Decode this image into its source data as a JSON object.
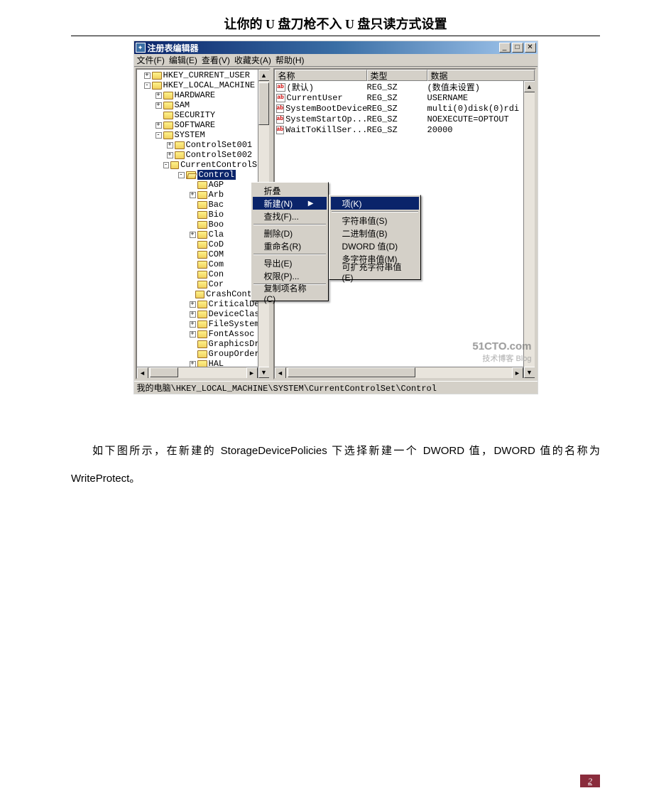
{
  "page": {
    "title": "让你的 U 盘刀枪不入  U 盘只读方式设置",
    "paragraph": "如下图所示，在新建的 StorageDevicePolicies 下选择新建一个 DWORD 值，DWORD 值的名称为 WriteProtect。",
    "number": "2"
  },
  "window": {
    "title": "注册表编辑器",
    "menus": {
      "file": "文件(F)",
      "edit": "编辑(E)",
      "view": "查看(V)",
      "favorites": "收藏夹(A)",
      "help": "帮助(H)"
    },
    "status": "我的电脑\\HKEY_LOCAL_MACHINE\\SYSTEM\\CurrentControlSet\\Control",
    "watermark": {
      "line1": "51CTO.com",
      "line2": "技术博客   Blog"
    }
  },
  "tree": {
    "top": [
      {
        "depth": 0,
        "toggle": "+",
        "label": "HKEY_CURRENT_USER"
      },
      {
        "depth": 0,
        "toggle": "-",
        "label": "HKEY_LOCAL_MACHINE"
      },
      {
        "depth": 1,
        "toggle": "+",
        "label": "HARDWARE"
      },
      {
        "depth": 1,
        "toggle": "+",
        "label": "SAM"
      },
      {
        "depth": 1,
        "toggle": "",
        "label": "SECURITY"
      },
      {
        "depth": 1,
        "toggle": "+",
        "label": "SOFTWARE"
      },
      {
        "depth": 1,
        "toggle": "-",
        "label": "SYSTEM"
      },
      {
        "depth": 2,
        "toggle": "+",
        "label": "ControlSet001"
      },
      {
        "depth": 2,
        "toggle": "+",
        "label": "ControlSet002"
      },
      {
        "depth": 2,
        "toggle": "-",
        "label": "CurrentControlSet"
      },
      {
        "depth": 3,
        "toggle": "-",
        "label": "Control",
        "selected": true,
        "open": true
      }
    ],
    "children": [
      "AGP",
      "Arb",
      "Bac",
      "Bio",
      "Boo",
      "Cla",
      "CoD",
      "COM",
      "Com",
      "Con",
      "Cor",
      "CrashControl",
      "CriticalDe",
      "DeviceClas",
      "FileSystem",
      "FontAssoc",
      "GraphicsDr",
      "GroupOrder",
      "HAL"
    ],
    "childToggles": [
      "",
      "+",
      "",
      "",
      "",
      "+",
      "",
      "",
      "",
      "",
      "",
      "",
      "+",
      "+",
      "+",
      "+",
      "",
      "",
      "+"
    ]
  },
  "list": {
    "headers": {
      "name": "名称",
      "type": "类型",
      "data": "数据"
    },
    "rows": [
      {
        "name": "(默认)",
        "type": "REG_SZ",
        "data": "(数值未设置)"
      },
      {
        "name": "CurrentUser",
        "type": "REG_SZ",
        "data": "USERNAME"
      },
      {
        "name": "SystemBootDevice",
        "type": "REG_SZ",
        "data": "multi(0)disk(0)rdi"
      },
      {
        "name": "SystemStartOp...",
        "type": "REG_SZ",
        "data": "NOEXECUTE=OPTOUT"
      },
      {
        "name": "WaitToKillSer...",
        "type": "REG_SZ",
        "data": "20000"
      }
    ]
  },
  "contextMenu": {
    "items": {
      "collapse": "折叠",
      "new": "新建(N)",
      "find": "查找(F)...",
      "delete": "删除(D)",
      "rename": "重命名(R)",
      "export": "导出(E)",
      "permissions": "权限(P)...",
      "copyKeyName": "复制项名称(C)"
    },
    "newSubmenu": {
      "key": "项(K)",
      "string": "字符串值(S)",
      "binary": "二进制值(B)",
      "dword": "DWORD 值(D)",
      "multiString": "多字符串值(M)",
      "expandString": "可扩充字符串值(E)"
    }
  }
}
